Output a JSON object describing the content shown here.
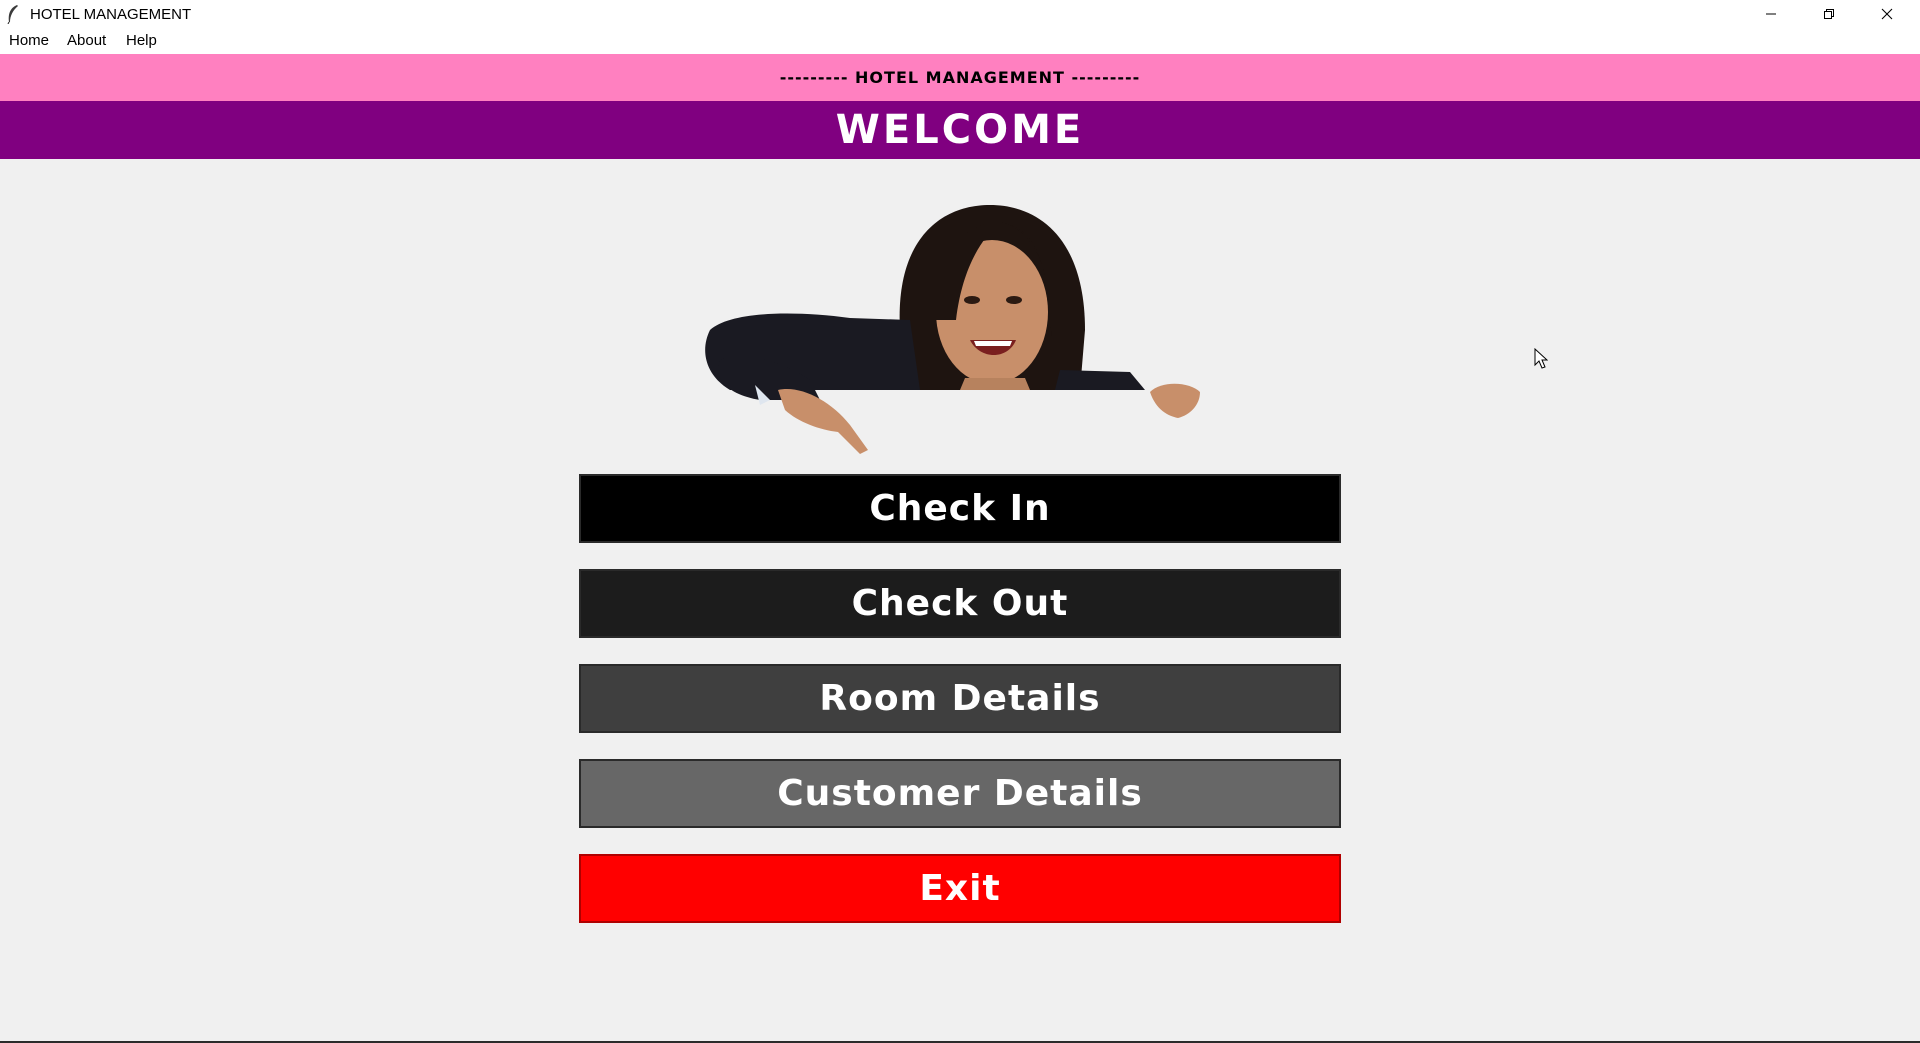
{
  "window": {
    "title": "HOTEL MANAGEMENT",
    "controls": {
      "minimize_icon": "minimize-icon",
      "maximize_icon": "restore-icon",
      "close_icon": "close-icon"
    }
  },
  "menubar": {
    "items": [
      {
        "label": "Home"
      },
      {
        "label": "About"
      },
      {
        "label": "Help"
      }
    ]
  },
  "header": {
    "subtitle": "--------- HOTEL MANAGEMENT ---------",
    "title": "WELCOME",
    "subtitle_bg": "#ff80c0",
    "title_bg": "#800080"
  },
  "image": {
    "icon": "receptionist-pointing-image"
  },
  "buttons": {
    "check_in": {
      "label": "Check In",
      "color": "#000000"
    },
    "check_out": {
      "label": "Check Out",
      "color": "#1c1c1c"
    },
    "room_details": {
      "label": "Room Details",
      "color": "#3f3f3f"
    },
    "customer_details": {
      "label": "Customer Details",
      "color": "#676767"
    },
    "exit": {
      "label": "Exit",
      "color": "#ff0000"
    }
  }
}
